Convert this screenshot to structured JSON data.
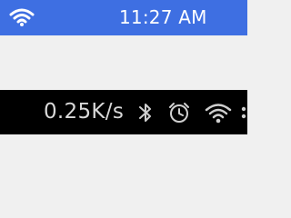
{
  "status_bar_top": {
    "time": "11:27 AM",
    "wifi_icon": "wifi-icon",
    "background_color": "#3e6fe2"
  },
  "status_bar_bottom": {
    "network_speed": "0.25K/s",
    "icons": [
      "bluetooth-icon",
      "alarm-icon",
      "wifi-icon",
      "overflow-icon"
    ],
    "background_color": "#000000"
  }
}
